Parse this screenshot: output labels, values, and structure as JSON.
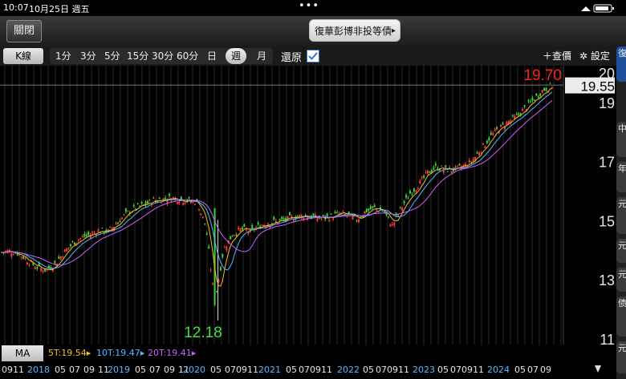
{
  "status_bar": {
    "time": "10:07",
    "date": "10月25日 週五",
    "dots": "•••"
  },
  "title_bar": {
    "close_label": "關閉",
    "fund_name": "復華彭博非投等債",
    "fund_arrow": "▸"
  },
  "toolbar": {
    "kline_label": "K線",
    "periods": [
      "1分",
      "3分",
      "5分",
      "15分",
      "30分",
      "60分",
      "日",
      "週",
      "月"
    ],
    "selected_period": "週",
    "restore_label": "還原",
    "restore_checked": true,
    "query_label": "＋查價",
    "settings_label": "✲ 設定"
  },
  "right_strip_tabs": [
    "復",
    "中",
    "年",
    "元",
    "元",
    "元",
    "债",
    "元"
  ],
  "chart_data": {
    "type": "candlestick",
    "ylim": [
      11,
      20
    ],
    "y_ticks": [
      "20",
      "19",
      "17",
      "15",
      "13",
      "11"
    ],
    "current_price": "19.55",
    "max_label": "19.70",
    "min_label": "12.18",
    "x_labels": [
      {
        "text": "0911",
        "year": false
      },
      {
        "text": "2018",
        "year": true
      },
      {
        "text": "05",
        "year": false
      },
      {
        "text": "07",
        "year": false
      },
      {
        "text": "09",
        "year": false
      },
      {
        "text": "11",
        "year": false
      },
      {
        "text": "2019",
        "year": true
      },
      {
        "text": "05",
        "year": false
      },
      {
        "text": "07",
        "year": false
      },
      {
        "text": "09",
        "year": false
      },
      {
        "text": "11",
        "year": false
      },
      {
        "text": "2020",
        "year": true
      },
      {
        "text": "05",
        "year": false
      },
      {
        "text": "07",
        "year": false
      },
      {
        "text": "0911",
        "year": false
      },
      {
        "text": "2021",
        "year": true
      },
      {
        "text": "05",
        "year": false
      },
      {
        "text": "07",
        "year": false
      },
      {
        "text": "0911",
        "year": false
      },
      {
        "text": "2022",
        "year": true
      },
      {
        "text": "05",
        "year": false
      },
      {
        "text": "07",
        "year": false
      },
      {
        "text": "0911",
        "year": false
      },
      {
        "text": "2023",
        "year": true
      },
      {
        "text": "05",
        "year": false
      },
      {
        "text": "07",
        "year": false
      },
      {
        "text": "0911",
        "year": false
      },
      {
        "text": "2024",
        "year": true
      },
      {
        "text": "05",
        "year": false
      },
      {
        "text": "07",
        "year": false
      },
      {
        "text": "09",
        "year": false
      }
    ],
    "price_path": [
      13.9,
      13.95,
      13.85,
      13.6,
      13.4,
      13.3,
      13.5,
      13.9,
      14.2,
      14.4,
      14.5,
      14.65,
      14.6,
      14.9,
      15.2,
      15.4,
      15.5,
      15.65,
      15.7,
      15.75,
      15.7,
      15.65,
      15.6,
      14.8,
      12.2,
      14.0,
      14.5,
      14.7,
      14.6,
      14.8,
      14.9,
      14.95,
      15.0,
      15.1,
      15.15,
      15.1,
      15.05,
      15.1,
      15.2,
      15.15,
      15.0,
      15.3,
      15.4,
      15.3,
      14.8,
      15.4,
      15.9,
      16.2,
      16.6,
      16.8,
      16.7,
      16.7,
      16.8,
      17.0,
      17.4,
      17.8,
      18.1,
      18.3,
      18.5,
      18.8,
      19.1,
      19.4,
      19.55
    ],
    "ma5_label": "5T:19.54",
    "ma10_label": "10T:19.47",
    "ma20_label": "20T:19.41",
    "ma_button": "MA"
  },
  "colors": {
    "up": "#ff3a3a",
    "down": "#3ad23a",
    "ma5": "#f0c020",
    "ma10": "#56b8ff",
    "ma20": "#c860ff",
    "year_label": "#56b8ff",
    "max": "#ff2020",
    "min": "#40e040"
  }
}
